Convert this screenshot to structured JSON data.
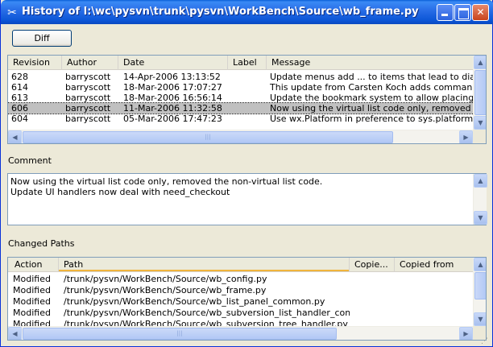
{
  "window": {
    "title": "History of l:\\wc\\pysvn\\trunk\\pysvn\\WorkBench\\Source\\wb_frame.py"
  },
  "toolbar": {
    "diff_label": "Diff"
  },
  "history": {
    "columns": [
      "Revision",
      "Author",
      "Date",
      "Label",
      "Message"
    ],
    "rows": [
      {
        "revision": "628",
        "author": "barryscott",
        "date": "14-Apr-2006 13:13:52",
        "label": "",
        "message": "Update menus add ... to items that lead to dialogs re"
      },
      {
        "revision": "614",
        "author": "barryscott",
        "date": "18-Mar-2006 17:07:27",
        "label": "",
        "message": "This update from Carsten Koch adds commands to dil"
      },
      {
        "revision": "613",
        "author": "barryscott",
        "date": "18-Mar-2006 16:56:14",
        "label": "",
        "message": "Update the bookmark system to allow placing book m"
      },
      {
        "revision": "606",
        "author": "barryscott",
        "date": "11-Mar-2006 11:32:58",
        "label": "",
        "message": "Now using the virtual list code only, removed the nor"
      },
      {
        "revision": "604",
        "author": "barryscott",
        "date": "05-Mar-2006 17:47:23",
        "label": "",
        "message": "Use wx.Platform in preference to sys.platform where"
      }
    ],
    "selected_index": 3
  },
  "comment": {
    "label": "Comment",
    "lines": [
      "Now using the virtual list code only, removed the non-virtual list code.",
      "Update UI handlers now deal with need_checkout"
    ]
  },
  "changed_paths": {
    "label": "Changed Paths",
    "columns": [
      "Action",
      "Path",
      "Copie...",
      "Copied from"
    ],
    "rows": [
      {
        "action": "Modified",
        "path": "/trunk/pysvn/WorkBench/Source/wb_config.py"
      },
      {
        "action": "Modified",
        "path": "/trunk/pysvn/WorkBench/Source/wb_frame.py"
      },
      {
        "action": "Modified",
        "path": "/trunk/pysvn/WorkBench/Source/wb_list_panel_common.py"
      },
      {
        "action": "Modified",
        "path": "/trunk/pysvn/WorkBench/Source/wb_subversion_list_handler_commo..."
      },
      {
        "action": "Modified",
        "path": "/trunk/pysvn/WorkBench/Source/wb_subversion_tree_handler.py"
      }
    ]
  },
  "icons": {
    "title": "tools-icon",
    "minimize": "minimize-icon",
    "maximize": "maximize-icon",
    "close": "close-icon"
  }
}
